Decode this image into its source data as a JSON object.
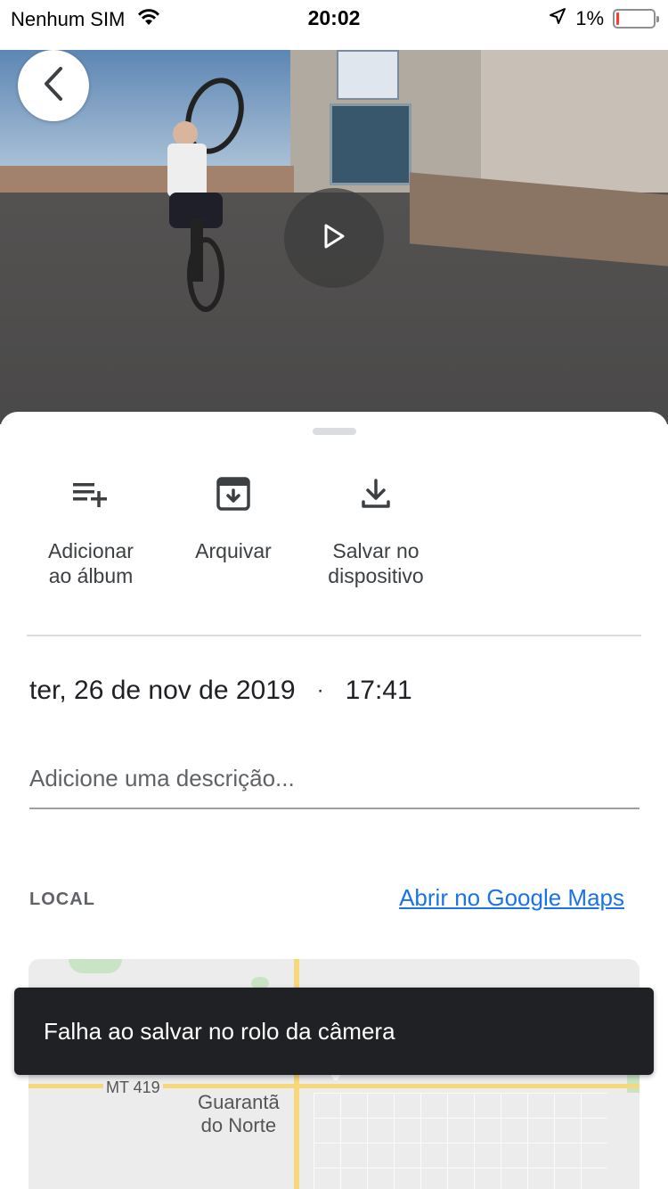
{
  "status_bar": {
    "carrier": "Nenhum SIM",
    "time": "20:02",
    "battery": "1%",
    "battery_level": 0.01,
    "icons": [
      "wifi-icon",
      "location-arrow-icon",
      "battery-icon"
    ]
  },
  "video": {
    "play_icon": "play-icon",
    "back_icon": "chevron-left-icon"
  },
  "actions": [
    {
      "label": "Adicionar\nao álbum",
      "icon": "playlist-add-icon"
    },
    {
      "label": "Arquivar",
      "icon": "archive-icon"
    },
    {
      "label": "Salvar no\ndispositivo",
      "icon": "download-icon"
    }
  ],
  "details": {
    "date": "ter, 26 de nov de 2019",
    "separator": "·",
    "time": "17:41",
    "description_placeholder": "Adicione uma descrição..."
  },
  "location": {
    "label": "LOCAL",
    "maps_link": "Abrir no Google Maps",
    "map_road_label": "MT 419",
    "map_city_line1": "Guarantã",
    "map_city_line2": "do Norte"
  },
  "toast": {
    "message": "Falha ao salvar no rolo da câmera"
  },
  "colors": {
    "accent": "#1a73e8",
    "toast_bg": "#202124",
    "battery_low": "#ff3b30"
  }
}
